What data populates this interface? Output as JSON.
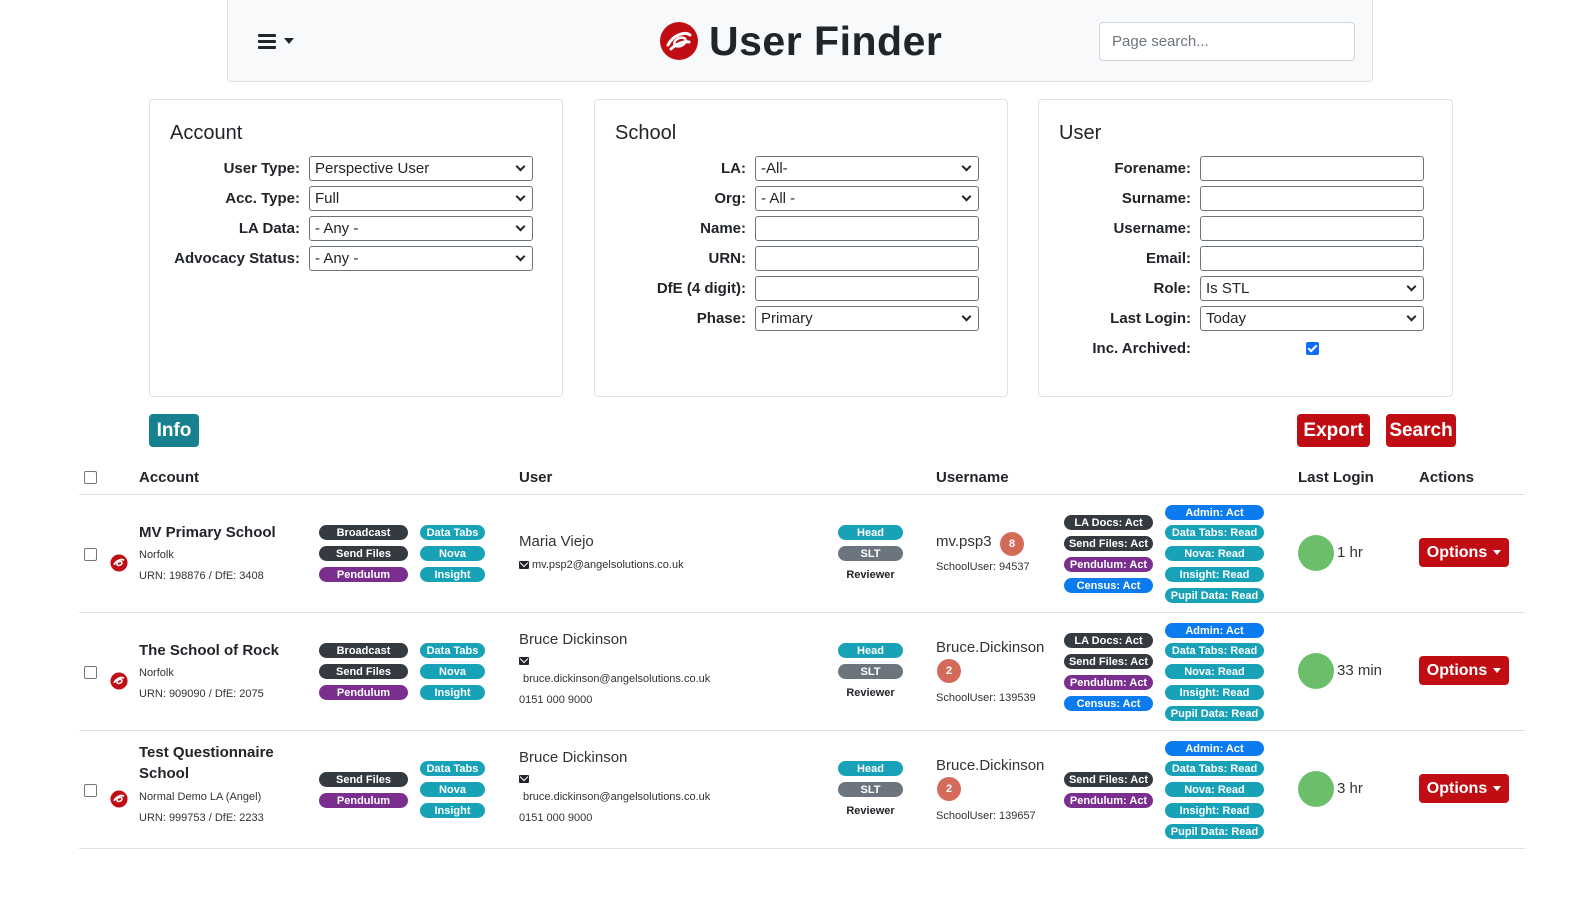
{
  "header": {
    "title": "User Finder",
    "search_placeholder": "Page search..."
  },
  "account": {
    "title": "Account",
    "user_type_label": "User Type:",
    "user_type_value": "Perspective User",
    "acc_type_label": "Acc. Type:",
    "acc_type_value": "Full",
    "la_data_label": "LA Data:",
    "la_data_value": "- Any -",
    "advocacy_label": "Advocacy Status:",
    "advocacy_value": "- Any -"
  },
  "school": {
    "title": "School",
    "la_label": "LA:",
    "la_value": "-All-",
    "org_label": "Org:",
    "org_value": "- All -",
    "name_label": "Name:",
    "urn_label": "URN:",
    "dfe_label": "DfE (4 digit):",
    "phase_label": "Phase:",
    "phase_value": "Primary"
  },
  "user": {
    "title": "User",
    "forename_label": "Forename:",
    "surname_label": "Surname:",
    "username_label": "Username:",
    "email_label": "Email:",
    "role_label": "Role:",
    "role_value": "Is STL",
    "last_login_label": "Last Login:",
    "last_login_value": "Today",
    "inc_archived_label": "Inc. Archived:",
    "inc_archived_checked": true
  },
  "buttons": {
    "info": "Info",
    "export": "Export",
    "search": "Search"
  },
  "table": {
    "columns": [
      "Account",
      "User",
      "Username",
      "Last Login",
      "Actions"
    ],
    "rows": [
      {
        "account_name": "MV Primary School",
        "account_name_2": "",
        "la": "Norfolk",
        "urn_dfe": "URN: 198876 / DfE: 3408",
        "modules_left": [
          "Broadcast",
          "Send Files",
          "Pendulum"
        ],
        "modules_right": [
          "Data Tabs",
          "Nova",
          "Insight"
        ],
        "user_name": "Maria Viejo",
        "email": "mv.psp2@angelsolutions.co.uk",
        "phone": "",
        "roles": [
          "Head",
          "SLT",
          "Reviewer"
        ],
        "username": "mv.psp3",
        "count": "8",
        "school_user": "SchoolUser: 94537",
        "perms_left": [
          "LA Docs: Act",
          "Send Files: Act",
          "Pendulum: Act",
          "Census: Act"
        ],
        "perms_right": [
          "Admin: Act",
          "Data Tabs: Read",
          "Nova: Read",
          "Insight: Read",
          "Pupil Data: Read"
        ],
        "last_login": "1 hr",
        "action": "Options"
      },
      {
        "account_name": "The School of Rock",
        "account_name_2": "",
        "la": "Norfolk",
        "urn_dfe": "URN: 909090 / DfE: 2075",
        "modules_left": [
          "Broadcast",
          "Send Files",
          "Pendulum"
        ],
        "modules_right": [
          "Data Tabs",
          "Nova",
          "Insight"
        ],
        "user_name": "Bruce Dickinson",
        "email": "bruce.dickinson@angelsolutions.co.uk",
        "phone": "0151 000 9000",
        "roles": [
          "Head",
          "SLT",
          "Reviewer"
        ],
        "username": "Bruce.Dickinson",
        "count": "2",
        "school_user": "SchoolUser: 139539",
        "perms_left": [
          "LA Docs: Act",
          "Send Files: Act",
          "Pendulum: Act",
          "Census: Act"
        ],
        "perms_right": [
          "Admin: Act",
          "Data Tabs: Read",
          "Nova: Read",
          "Insight: Read",
          "Pupil Data: Read"
        ],
        "last_login": "33 min",
        "action": "Options"
      },
      {
        "account_name": "Test Questionnaire",
        "account_name_2": "School",
        "la": "Normal Demo LA (Angel)",
        "urn_dfe": "URN: 999753 / DfE: 2233",
        "modules_left": [
          "Send Files",
          "Pendulum"
        ],
        "modules_right": [
          "Data Tabs",
          "Nova",
          "Insight"
        ],
        "user_name": "Bruce Dickinson",
        "email": "bruce.dickinson@angelsolutions.co.uk",
        "phone": "0151 000 9000",
        "roles": [
          "Head",
          "SLT",
          "Reviewer"
        ],
        "username": "Bruce.Dickinson",
        "count": "2",
        "school_user": "SchoolUser: 139657",
        "perms_left": [
          "Send Files: Act",
          "Pendulum: Act"
        ],
        "perms_right": [
          "Admin: Act",
          "Data Tabs: Read",
          "Nova: Read",
          "Insight: Read",
          "Pupil Data: Read"
        ],
        "last_login": "3 hr",
        "action": "Options"
      }
    ]
  },
  "colors": {
    "brand_red": "#c00d14",
    "info_teal": "#17818f",
    "online_green": "#6bbf6b"
  }
}
